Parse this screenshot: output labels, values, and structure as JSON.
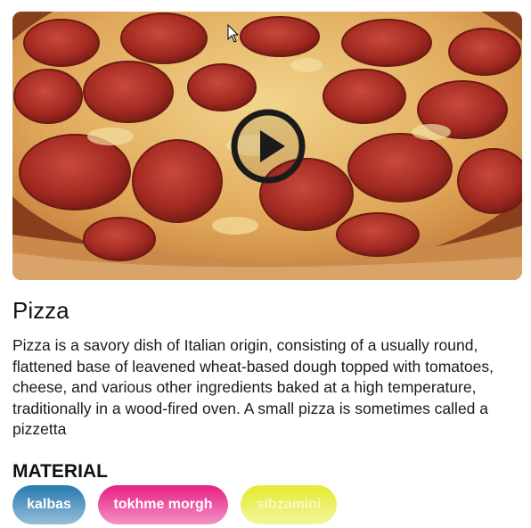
{
  "card": {
    "title": "Pizza",
    "description": "Pizza is a savory dish of Italian origin, consisting of a usually round, flattened base of leavened wheat-based dough topped with tomatoes, cheese, and various other ingredients baked at a high temperature, traditionally in a wood-fired oven. A small pizza is sometimes called a pizzetta",
    "media": {
      "image": "pepperoni-pizza-photo",
      "play_icon": "play-icon"
    },
    "materials": {
      "heading": "MATERIAL",
      "chips": [
        {
          "label": "kalbas",
          "color": "#2f7fb3"
        },
        {
          "label": "tokhme morgh",
          "color": "#e8288a"
        },
        {
          "label": "sibzamini",
          "color": "#e6ec3a"
        }
      ]
    }
  }
}
